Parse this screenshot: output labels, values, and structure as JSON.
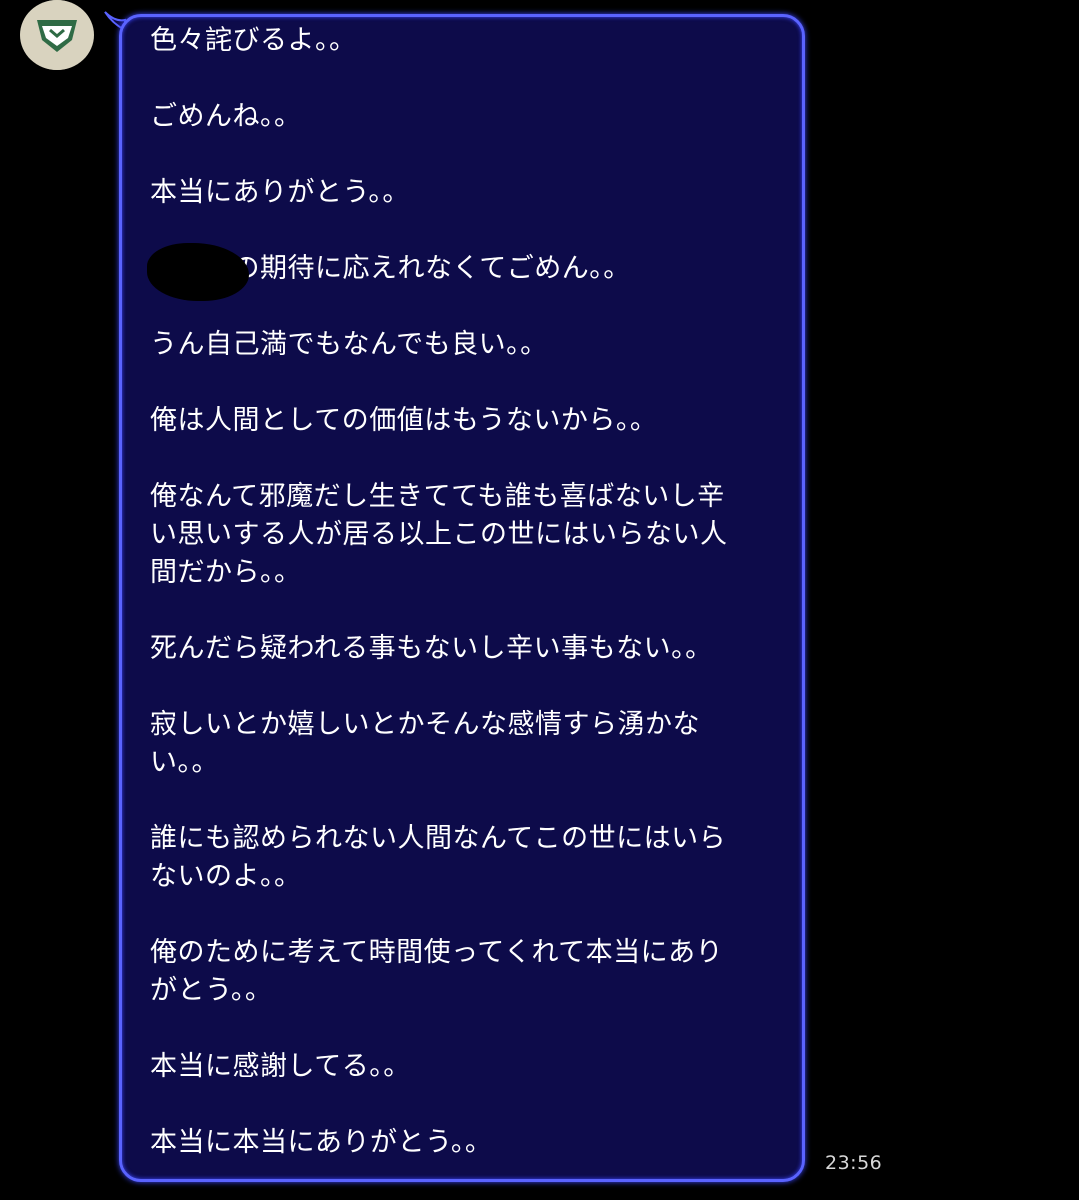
{
  "chat": {
    "avatar_icon": "avatar-icon",
    "bubble_colors": {
      "background": "#0d0b4a",
      "border": "#5a63ff"
    },
    "message": {
      "paragraphs": [
        [
          "色々詫びるよ。。"
        ],
        [
          "ごめんね。。"
        ],
        [
          "本当にありがとう。。"
        ],
        [
          "　　　の期待に応えれなくてごめん。。"
        ],
        [
          "うん自己満でもなんでも良い。。"
        ],
        [
          "俺は人間としての価値はもうないから。。"
        ],
        [
          "俺なんて邪魔だし生きてても誰も喜ばないし辛",
          "い思いする人が居る以上この世にはいらない人",
          "間だから。。"
        ],
        [
          "死んだら疑われる事もないし辛い事もない。。"
        ],
        [
          "寂しいとか嬉しいとかそんな感情すら湧かな",
          "い。。"
        ],
        [
          "誰にも認められない人間なんてこの世にはいら",
          "ないのよ。。"
        ],
        [
          "俺のために考えて時間使ってくれて本当にあり",
          "がとう。。"
        ],
        [
          "本当に感謝してる。。"
        ],
        [
          "本当に本当にありがとう。。"
        ]
      ]
    },
    "timestamp": "23:56"
  }
}
